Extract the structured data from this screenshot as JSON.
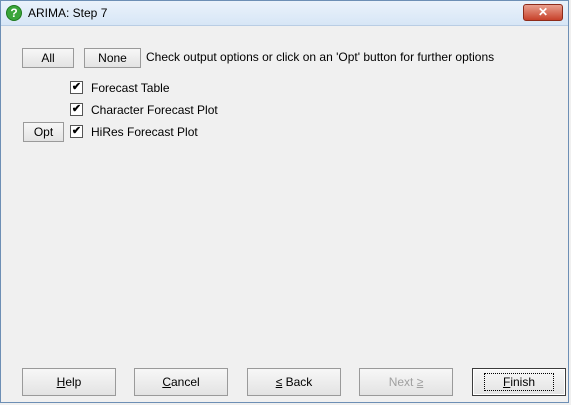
{
  "window": {
    "title": "ARIMA: Step 7",
    "close_label": "✕"
  },
  "toolbar": {
    "all_label": "All",
    "none_label": "None",
    "instruction": "Check output options or click on an 'Opt' button for further options"
  },
  "options": [
    {
      "label": "Forecast Table",
      "checked": true
    },
    {
      "label": "Character Forecast Plot",
      "checked": true
    },
    {
      "label": "HiRes Forecast Plot",
      "checked": true
    }
  ],
  "opt_button_label": "Opt",
  "footer": {
    "help": {
      "accel": "H",
      "rest": "elp"
    },
    "cancel": {
      "accel": "C",
      "rest": "ancel"
    },
    "back": {
      "accel": "≤",
      "rest": " Back"
    },
    "next": {
      "pre": "Next ",
      "accel": "≥"
    },
    "finish": {
      "accel": "F",
      "rest": "inish"
    }
  },
  "check_glyph": "✔",
  "icons": {
    "title": "help-circle-icon",
    "close": "close-icon"
  },
  "colors": {
    "title_icon": "#3aa53a",
    "close_button": "#c7412a"
  }
}
